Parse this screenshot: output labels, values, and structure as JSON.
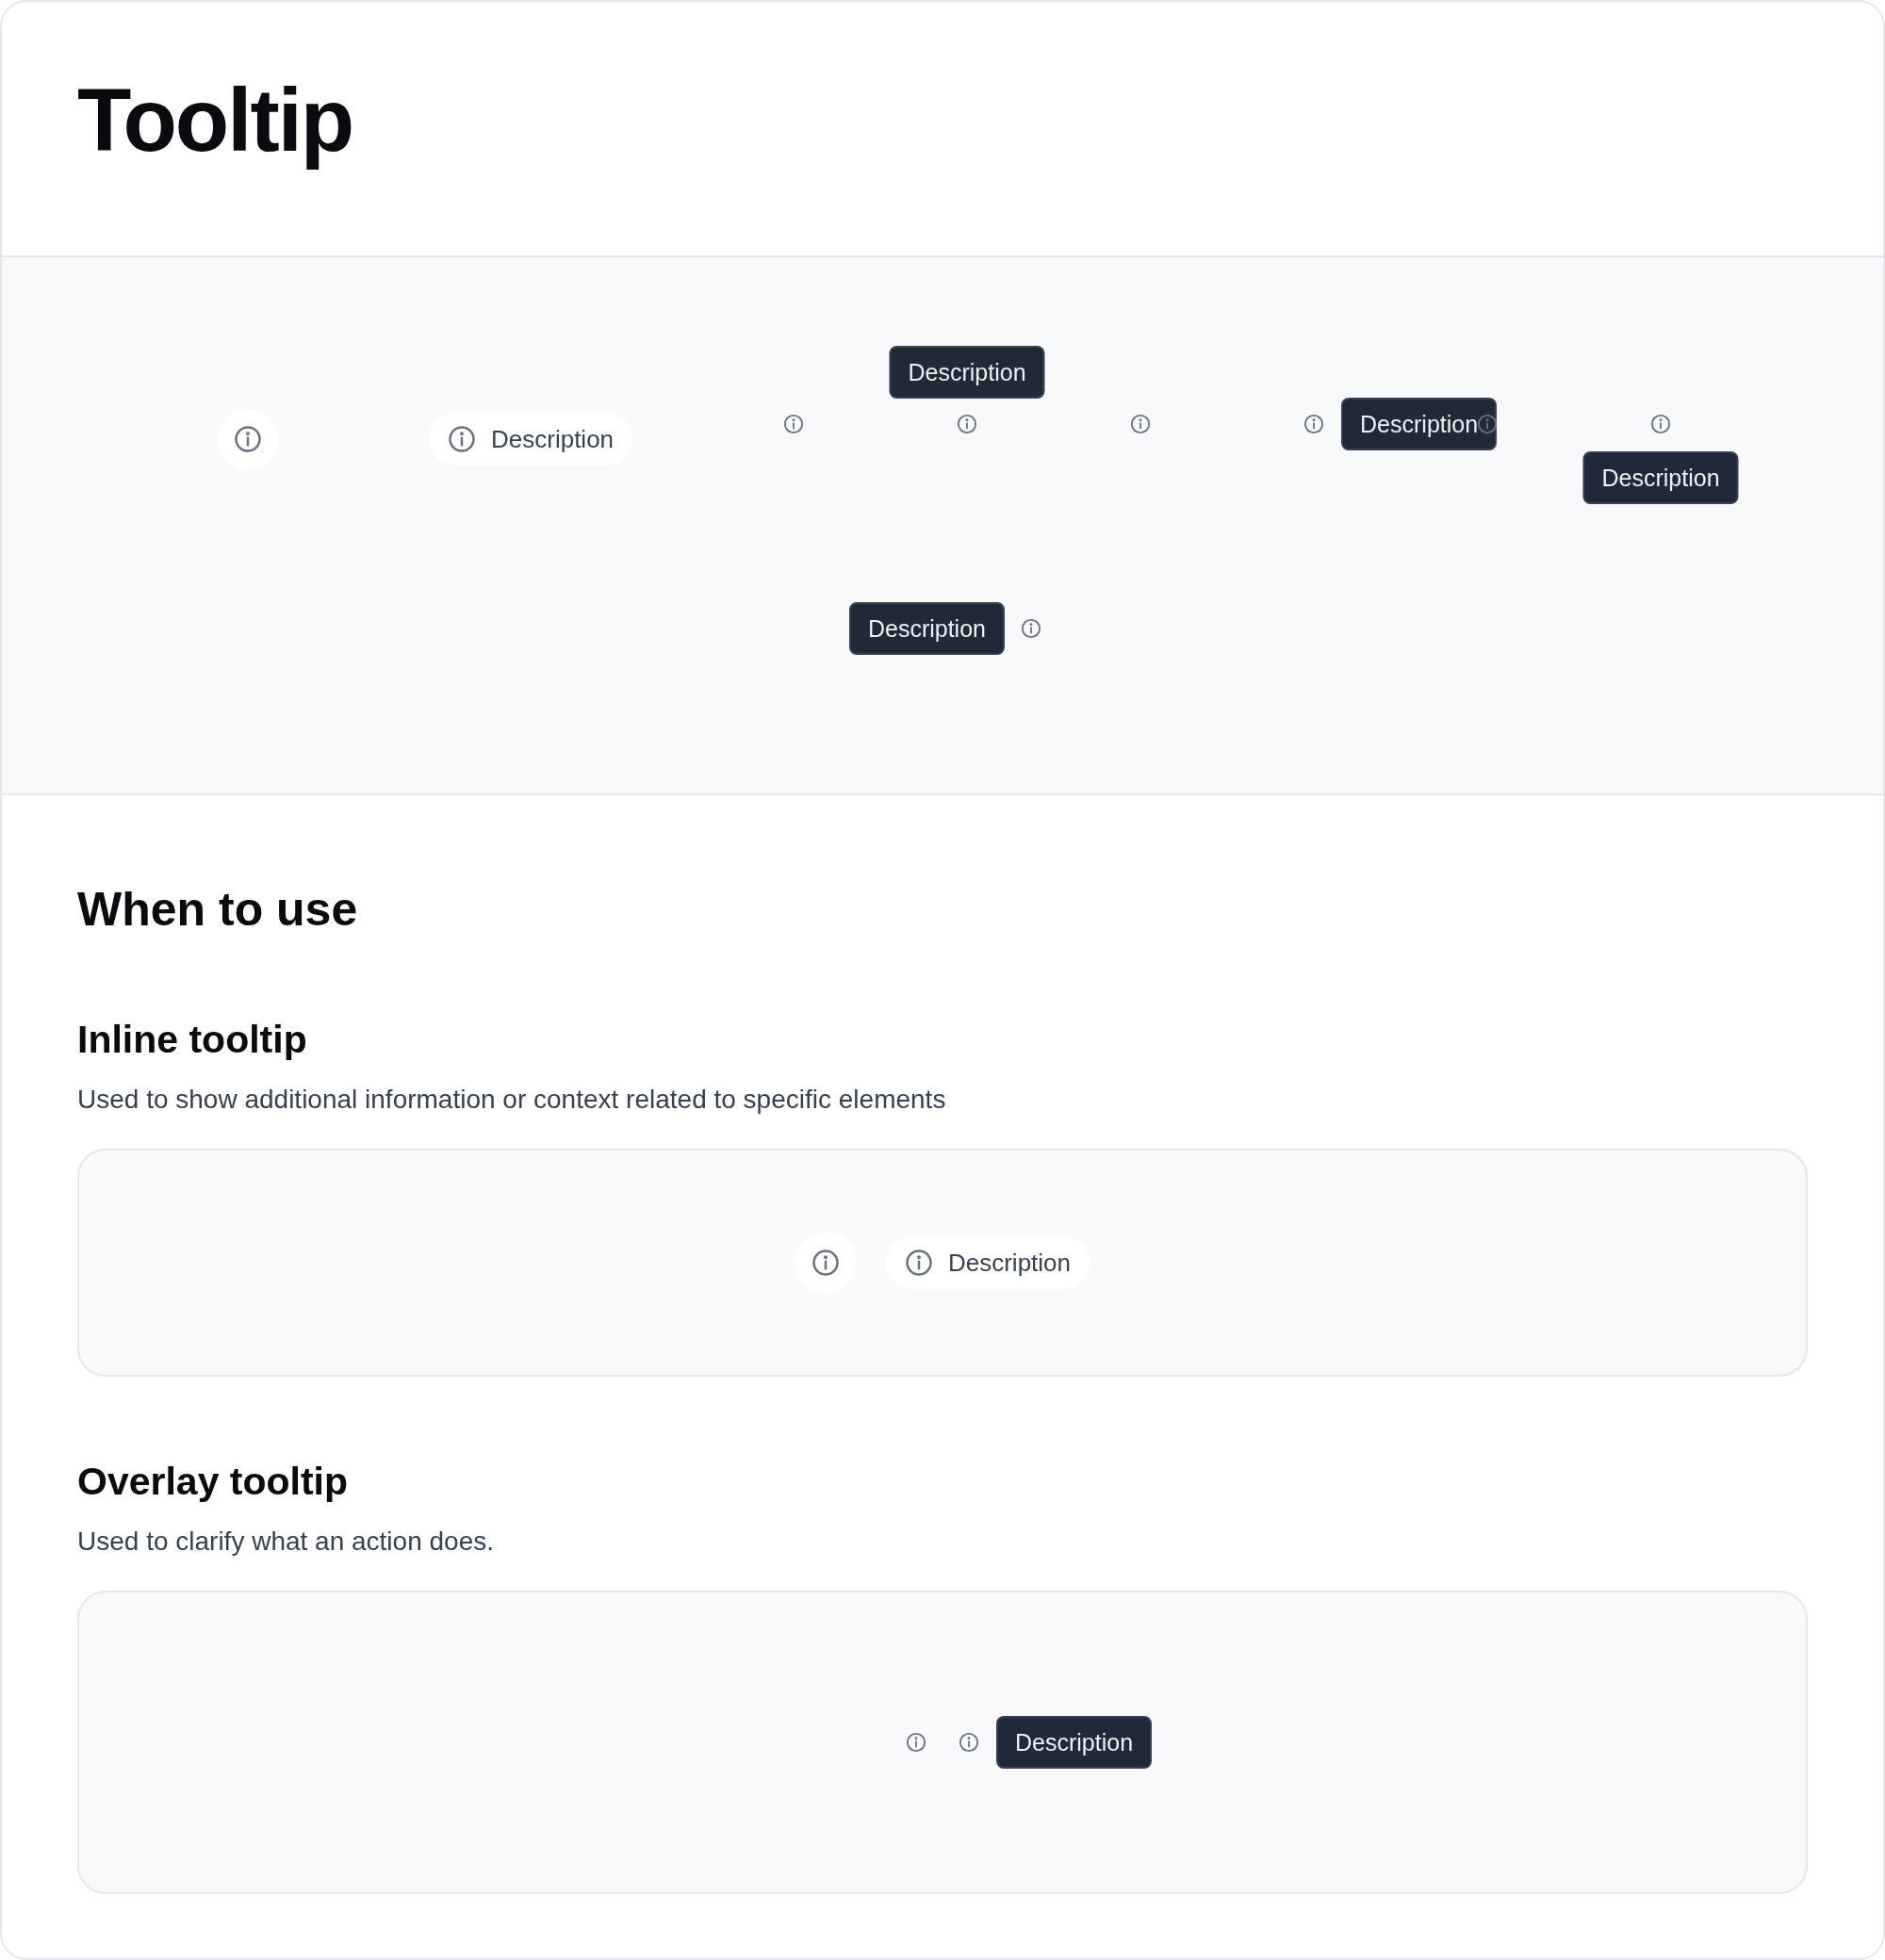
{
  "title": "Tooltip",
  "demo": {
    "rows": [
      {
        "items": [
          {
            "kind": "icon-pill"
          },
          {
            "kind": "text-pill",
            "label": "Description"
          },
          {
            "kind": "icon"
          },
          {
            "kind": "icon-tip-top",
            "tooltip": "Description"
          },
          {
            "kind": "icon"
          },
          {
            "kind": "icon-tip-right",
            "tooltip": "Description"
          },
          {
            "kind": "icon"
          },
          {
            "kind": "icon-tip-bottom",
            "tooltip": "Description"
          }
        ]
      },
      {
        "items": [
          {
            "kind": "icon-tip-left",
            "tooltip": "Description"
          }
        ]
      }
    ]
  },
  "section": {
    "heading": "When to use",
    "subsections": [
      {
        "heading": "Inline tooltip",
        "description": "Used to show additional information or context related to specific elements",
        "items": [
          {
            "kind": "icon-pill"
          },
          {
            "kind": "text-pill",
            "label": "Description"
          }
        ]
      },
      {
        "heading": "Overlay tooltip",
        "description": "Used to clarify what an action does.",
        "items": [
          {
            "kind": "icon"
          },
          {
            "kind": "icon-tip-right",
            "tooltip": "Description"
          }
        ]
      }
    ]
  }
}
